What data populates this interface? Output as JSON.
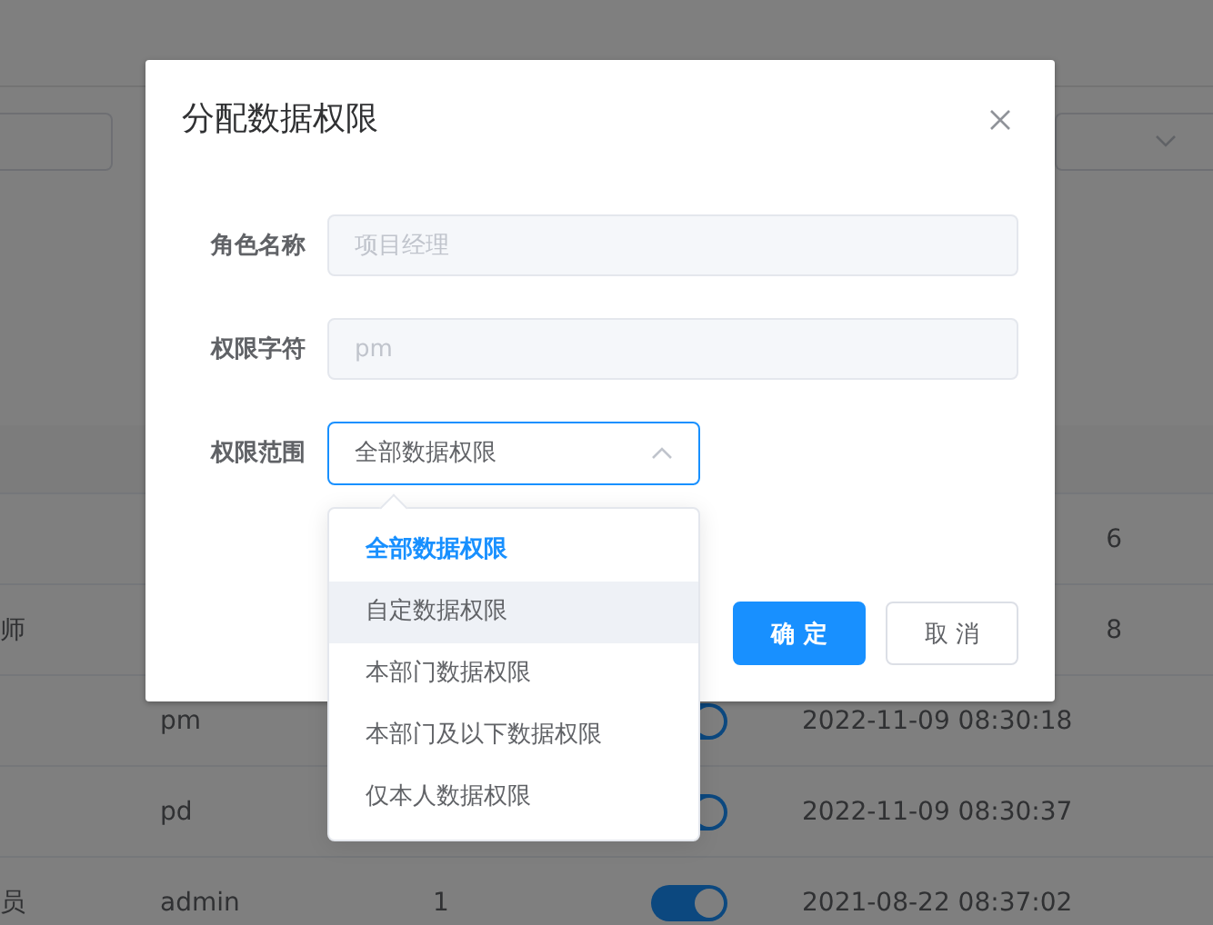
{
  "table": {
    "rows": [
      {
        "kind": "covered",
        "column_5": "6"
      },
      {
        "kind": "covered",
        "column_1": "师",
        "column_5": "8"
      },
      {
        "kind": "full",
        "column_2": "pm",
        "switch": {
          "on": true
        },
        "column_5": "2022-11-09 08:30:18"
      },
      {
        "kind": "full",
        "column_2": "pd",
        "switch": {
          "on": true
        },
        "column_5": "2022-11-09 08:30:37"
      },
      {
        "kind": "full",
        "column_1": "员",
        "column_2": "admin",
        "column_3": "1",
        "switch": {
          "on": true
        },
        "column_5": "2021-08-22 08:37:02"
      }
    ]
  },
  "dialog": {
    "title": "分配数据权限",
    "fields": [
      {
        "kind": "input",
        "label": "角色名称",
        "value": "项目经理",
        "disabled": true
      },
      {
        "kind": "input",
        "label": "权限字符",
        "value": "pm",
        "disabled": true
      },
      {
        "kind": "select",
        "label": "权限范围",
        "value": "全部数据权限",
        "expanded": true,
        "options": [
          {
            "label": "全部数据权限",
            "selected": true,
            "hovered": false
          },
          {
            "label": "自定数据权限",
            "selected": false,
            "hovered": true
          },
          {
            "label": "本部门数据权限",
            "selected": false,
            "hovered": false
          },
          {
            "label": "本部门及以下数据权限",
            "selected": false,
            "hovered": false
          },
          {
            "label": "仅本人数据权限",
            "selected": false,
            "hovered": false
          }
        ]
      }
    ],
    "buttons": [
      {
        "label": "确 定",
        "kind": "primary"
      },
      {
        "label": "取 消",
        "kind": "default"
      }
    ]
  }
}
